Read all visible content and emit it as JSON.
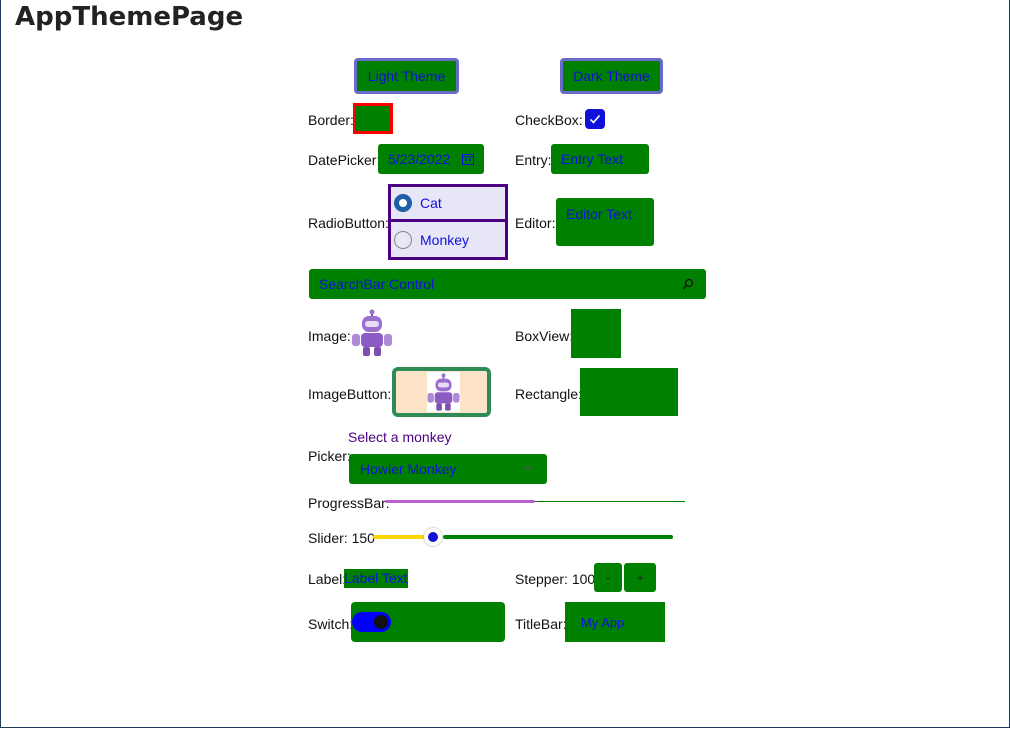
{
  "page": {
    "title": "AppThemePage"
  },
  "theme_buttons": {
    "light": "Light Theme",
    "dark": "Dark Theme"
  },
  "labels": {
    "border": "Border:",
    "checkbox": "CheckBox:",
    "datepicker": "DatePicker:",
    "entry": "Entry:",
    "radiobutton": "RadioButton:",
    "editor": "Editor:",
    "image": "Image:",
    "boxview": "BoxView:",
    "imagebutton": "ImageButton:",
    "rectangle": "Rectangle:",
    "picker": "Picker:",
    "progressbar": "ProgressBar:",
    "slider": "Slider: 150",
    "label": "Label:",
    "stepper": "Stepper: 100",
    "switch": "Switch:",
    "titlebar": "TitleBar:"
  },
  "checkbox": {
    "checked": true
  },
  "datepicker": {
    "value": "5/23/2022"
  },
  "entry": {
    "text": "Entry Text"
  },
  "radio": {
    "options": [
      "Cat",
      "Monkey"
    ],
    "selected": "Cat"
  },
  "editor": {
    "text": "Editor Text"
  },
  "searchbar": {
    "placeholder": "SearchBar Control"
  },
  "picker": {
    "title": "Select a monkey",
    "selected": "Howler Monkey"
  },
  "progressbar": {
    "progress": 0.5
  },
  "slider": {
    "value": 150,
    "fraction": 0.2
  },
  "label_control": {
    "text": "Label Text"
  },
  "stepper": {
    "minus": "-",
    "plus": "+",
    "value": 100
  },
  "switch": {
    "on": true
  },
  "titlebar": {
    "text": "My App"
  },
  "colors": {
    "control_bg": "#008000",
    "text_accent": "#1010d8",
    "border_red": "#ff0000",
    "radio_border": "#4b0082",
    "progress": "#b860d0",
    "slider_min": "#ffd700",
    "slider_thumb": "#1010d8",
    "switch_on": "#0000ff",
    "imagebutton_border": "#2e8b57"
  },
  "icons": {
    "datepicker": "calendar-icon",
    "search": "search-icon",
    "picker": "chevron-down-icon",
    "checkbox": "checkmark-icon",
    "image": "dotnet-bot-icon"
  }
}
